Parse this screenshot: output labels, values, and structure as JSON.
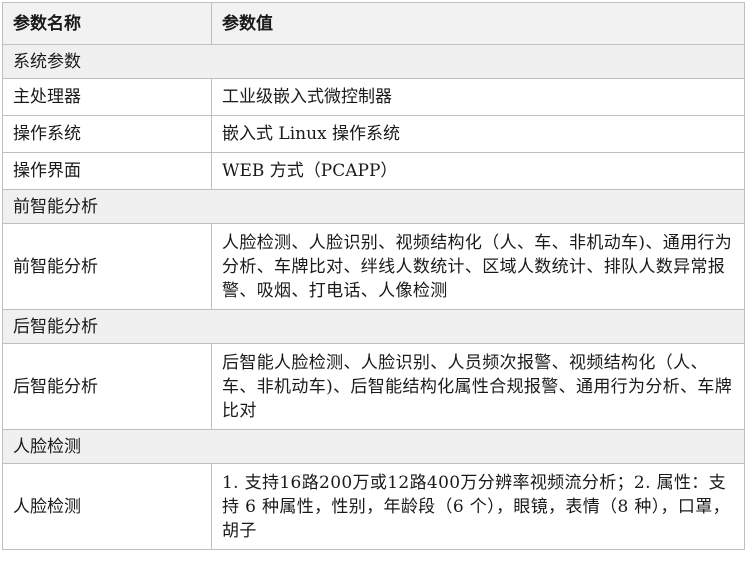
{
  "header": {
    "name": "参数名称",
    "value": "参数值"
  },
  "groups": [
    {
      "title": "系统参数",
      "rows": [
        {
          "name": "主处理器",
          "value": "工业级嵌入式微控制器"
        },
        {
          "name": "操作系统",
          "value": "嵌入式 Linux 操作系统"
        },
        {
          "name": "操作界面",
          "value": "WEB 方式（PCAPP）"
        }
      ]
    },
    {
      "title": "前智能分析",
      "rows": [
        {
          "name": "前智能分析",
          "value": "人脸检测、人脸识别、视频结构化（人、车、非机动车)、通用行为分析、车牌比对、绊线人数统计、区域人数统计、排队人数异常报警、吸烟、打电话、人像检测"
        }
      ]
    },
    {
      "title": "后智能分析",
      "rows": [
        {
          "name": "后智能分析",
          "value": "后智能人脸检测、人脸识别、人员频次报警、视频结构化（人、车、非机动车)、后智能结构化属性合规报警、通用行为分析、车牌比对"
        }
      ]
    },
    {
      "title": "人脸检测",
      "rows": [
        {
          "name": "人脸检测",
          "value": "1. 支持16路200万或12路400万分辨率视频流分析；2. 属性：支持 6 种属性，性别，年龄段（6 个），眼镜，表情（8 种），口罩，胡子"
        }
      ]
    }
  ]
}
